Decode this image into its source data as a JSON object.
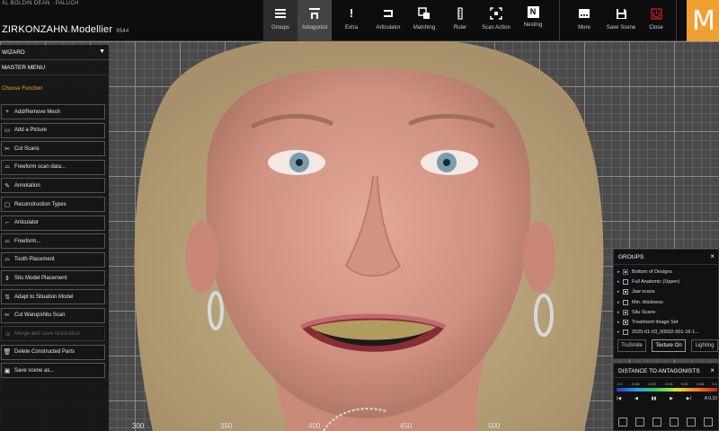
{
  "header": {
    "patient": "AL BOLDIN DEAN · PALUCH",
    "brand_a": "ZIRKONZAHN",
    "brand_sep": ".",
    "brand_b": "Modellier",
    "version": "9544",
    "logo_letter": "M",
    "tools": [
      {
        "label": "Groups",
        "icon": "menu-lines-icon"
      },
      {
        "label": "Antagonist",
        "icon": "antagonist-icon"
      },
      {
        "label": "Extra",
        "icon": "exclamation-icon"
      },
      {
        "label": "Articulator",
        "icon": "articulator-icon"
      },
      {
        "label": "Matching",
        "icon": "matching-icon"
      },
      {
        "label": "Ruler",
        "icon": "ruler-icon"
      },
      {
        "label": "Scan Action",
        "icon": "scan-action-icon"
      },
      {
        "label": "Nesting",
        "icon": "nesting-icon"
      }
    ],
    "right_tools": [
      {
        "label": "More",
        "icon": "more-icon"
      },
      {
        "label": "Save Scene",
        "icon": "save-icon"
      },
      {
        "label": "Close",
        "icon": "power-icon"
      }
    ],
    "nesting_glyph": "N",
    "extra_glyph": "!"
  },
  "left_panel": {
    "wizard": "WIZARD",
    "master_menu": "MASTER MENU",
    "choose_function": "Choose Function",
    "functions": [
      {
        "label": "Add/Remove Mesh",
        "icon": "+",
        "enabled": true
      },
      {
        "label": "Add a Picture",
        "icon": "▭",
        "enabled": true
      },
      {
        "label": "Cut Scans",
        "icon": "✂",
        "enabled": true
      },
      {
        "label": "Freeform scan data...",
        "icon": "⌓",
        "enabled": true
      },
      {
        "label": "Annotation",
        "icon": "✎",
        "enabled": true
      },
      {
        "label": "Reconstruction Types",
        "icon": "▢",
        "enabled": true
      },
      {
        "label": "Articulator",
        "icon": "⌐",
        "enabled": true
      },
      {
        "label": "Freeform...",
        "icon": "⌓",
        "enabled": true
      },
      {
        "label": "Tooth Placement",
        "icon": "⌓",
        "enabled": true
      },
      {
        "label": "Situ Model Placement",
        "icon": "⇕",
        "enabled": true
      },
      {
        "label": "Adapt to Situation Model",
        "icon": "⇅",
        "enabled": true
      },
      {
        "label": "Cut Warupshitu Scan",
        "icon": "✂",
        "enabled": true
      },
      {
        "label": "Merge and save restoration",
        "icon": "⇲",
        "enabled": false
      },
      {
        "label": "Delete Constructed Parts",
        "icon": "🗑",
        "enabled": true
      },
      {
        "label": "Save scene as...",
        "icon": "▣",
        "enabled": true
      }
    ]
  },
  "ruler": [
    "300",
    "350",
    "400",
    "450",
    "500"
  ],
  "groups_panel": {
    "title": "GROUPS",
    "close": "×",
    "items": [
      {
        "label": "Bottom of Designs",
        "checked": true,
        "style": "blue"
      },
      {
        "label": "Full Anatomic (Upper)",
        "checked": false,
        "style": ""
      },
      {
        "label": "Jaw scans",
        "checked": true,
        "style": ""
      },
      {
        "label": "Min. thickness",
        "checked": false,
        "style": ""
      },
      {
        "label": "Situ Scans",
        "checked": true,
        "style": "teal"
      },
      {
        "label": "Treatment Image Set",
        "checked": true,
        "style": ""
      },
      {
        "label": "2025-01-03_00002-001-16-1...",
        "checked": false,
        "style": ""
      }
    ],
    "buttons": [
      "TruSmile",
      "Texture On",
      "Lighting"
    ]
  },
  "distance_panel": {
    "title": "DISTANCE TO ANTAGONISTS",
    "close": "×",
    "scale": [
      "-0.1",
      "-0.08",
      "-0.02",
      "-0.04",
      "0.02",
      "0.08",
      "0.1"
    ],
    "controls": [
      "|◀",
      "◀",
      "▮▮",
      "▶",
      "▶|",
      "A 0.10"
    ]
  }
}
